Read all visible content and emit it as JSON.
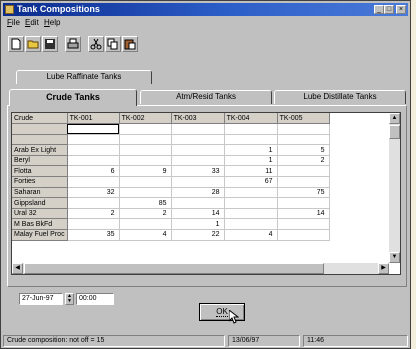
{
  "window": {
    "title": "Tank Compositions",
    "controls": {
      "minimize": "_",
      "maximize": "□",
      "close": "×"
    }
  },
  "menu": [
    "File",
    "Edit",
    "Help"
  ],
  "toolbar": {
    "icons": [
      "new-document-icon",
      "open-folder-icon",
      "save-disk-icon",
      "print-icon",
      "cut-icon",
      "copy-icon",
      "paste-icon"
    ]
  },
  "tabs": {
    "back_row": [
      "Lube Raffinate Tanks"
    ],
    "front_row": [
      "Crude Tanks",
      "Atm/Resid Tanks",
      "Lube Distillate Tanks"
    ],
    "active": "Crude Tanks"
  },
  "grid": {
    "columns": [
      "Crude",
      "TK-001",
      "TK-002",
      "TK-003",
      "TK-004",
      "TK-005"
    ],
    "rows": [
      [
        "",
        "",
        "",
        "",
        "",
        ""
      ],
      [
        "",
        "",
        "",
        "",
        "",
        ""
      ],
      [
        "Arab Ex Light",
        "",
        "",
        "",
        "1",
        "5"
      ],
      [
        "Beryl",
        "",
        "",
        "",
        "1",
        "2"
      ],
      [
        "Flotta",
        "6",
        "9",
        "33",
        "11",
        ""
      ],
      [
        "Forties",
        "",
        "",
        "",
        "67",
        ""
      ],
      [
        "Saharan",
        "32",
        "",
        "28",
        "",
        "75"
      ],
      [
        "Gippsland",
        "",
        "85",
        "",
        "",
        ""
      ],
      [
        "Ural 32",
        "2",
        "2",
        "14",
        "",
        "14"
      ],
      [
        "M Bas BkFd",
        "",
        "",
        "1",
        "",
        ""
      ],
      [
        "Malay Fuel Proc",
        "35",
        "4",
        "22",
        "4",
        ""
      ]
    ]
  },
  "datetime": {
    "date": "27-Jun-97",
    "time": "00:00"
  },
  "ok_button": "OK",
  "status": {
    "message": "Crude composition: not off = 15",
    "date": "13/06/97",
    "time": "11:46"
  },
  "colors": {
    "titlebar_start": "#0a2a8c",
    "titlebar_end": "#4a7ad8",
    "chrome": "#c0c0c0",
    "grid_background": "#ffffff"
  }
}
